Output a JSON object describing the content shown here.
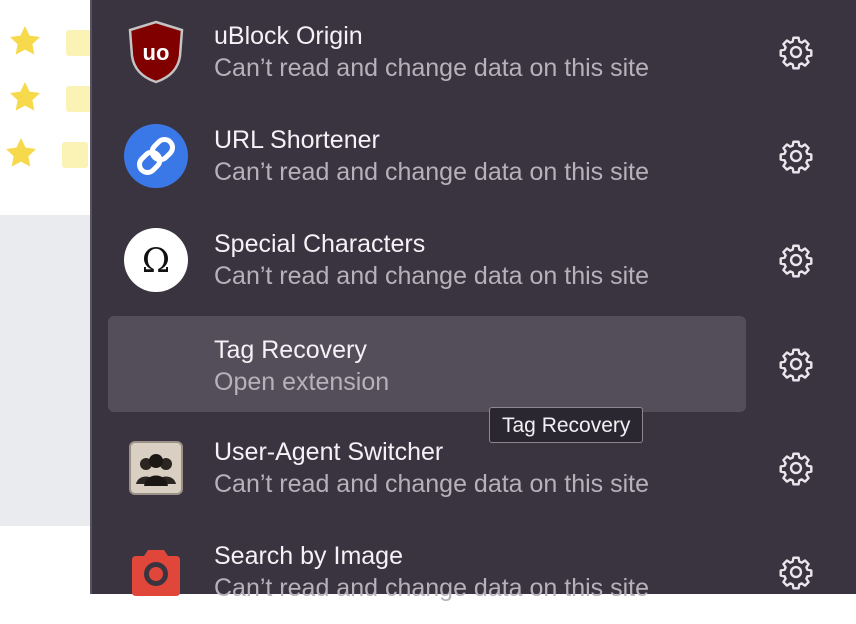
{
  "extensions": [
    {
      "name": "uBlock Origin",
      "status": "Can’t read and change data on this site",
      "icon": "ublock-shield-icon"
    },
    {
      "name": "URL Shortener",
      "status": "Can’t read and change data on this site",
      "icon": "chain-link-icon"
    },
    {
      "name": "Special Characters",
      "status": "Can’t read and change data on this site",
      "icon": "omega-icon"
    },
    {
      "name": "Tag Recovery",
      "status": "Open extension",
      "icon": "",
      "hovered": true
    },
    {
      "name": "User-Agent Switcher",
      "status": "Can’t read and change data on this site",
      "icon": "user-agent-icon"
    },
    {
      "name": "Search by Image",
      "status": "Can’t read and change data on this site",
      "icon": "camera-icon"
    }
  ],
  "tooltip": {
    "text": "Tag Recovery"
  },
  "background": {
    "star_color": "#f7d94c",
    "bar_color": "#fbf2b6"
  },
  "colors": {
    "panel_bg": "#3a3440",
    "hover_bg": "#544e5a",
    "text_primary": "#f4f2f6",
    "text_secondary": "#b6b1bb"
  }
}
